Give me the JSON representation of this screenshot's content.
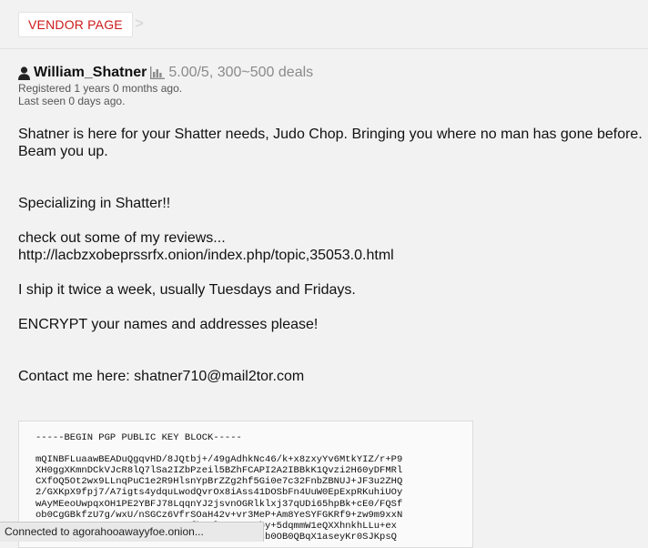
{
  "nav": {
    "vendor_page_label": "VENDOR PAGE",
    "separator": ">"
  },
  "vendor": {
    "name": "William_Shatner",
    "rating": "5.00/5, 300~500 deals",
    "registered": "Registered 1 years 0 months ago.",
    "last_seen": "Last seen 0 days ago."
  },
  "description": {
    "line1": "Shatner is here for your Shatter needs, Judo Chop. Bringing you where no man has gone before.",
    "line2": "Beam you up.",
    "specializing": "Specializing in Shatter!!",
    "reviews_intro": "check out some of my reviews...",
    "reviews_link": "http://lacbzxobeprssrfx.onion/index.php/topic,35053.0.html",
    "shipping": "I ship it twice a week, usually Tuesdays and Fridays.",
    "encrypt": "ENCRYPT your names and addresses please!",
    "contact": "Contact me here: shatner710@mail2tor.com"
  },
  "pgp": {
    "header": "-----BEGIN PGP PUBLIC KEY BLOCK-----",
    "lines": [
      "mQINBFLuaawBEADuQgqvHD/8JQtbj+/49gAdhkNc46/k+x8zxyYv6MtkYIZ/r+P9",
      "XH0ggXKmnDCkVJcR8lQ7lSa2IZbPzeil5BZhFCAPI2A2IBBkK1Qvzi2H60yDFMRl",
      "CXfOQ5Ot2wx9LLnqPuC1e2R9HlsnYpBrZZg2hf5Gi0e7c32FnbZBNUJ+JF3u2ZHQ",
      "2/GXKpX9fpj7/A7igts4ydquLwodQvrOx8iAss41DOSbFn4UuW0EpExpRKuhiUOy",
      "wAyMEeoUwpqxOH1PE2YBFJ78LqqnYJ2jsvnOGRlklxj37qUDi65hpBk+cE0/FQSf",
      "ob0CgGBkfzU7g/wxU/nSGCz6VfrSOaH42v+vr3MeP+Am8YeSYFGKRf9+zw9m9xxN",
      "w4tCHBRYvuQ1sOEDmaPnoFw6xFqfkgPlUYZzZymby+5dqmmW1eQXXhnkhLLu+ex",
      "kPaDN8bRwYkVLkmQTqqRxb9pLjWJyzGm2fk7Mwusb0OB0QBqX1aseyKr0SJKpsQ"
    ]
  },
  "statusbar": {
    "text": "Connected to agorahooawayyfoe.onion..."
  },
  "colors": {
    "accent": "#cc1a1a",
    "background": "#f2f2f2",
    "muted": "#8a8a8a"
  },
  "icons": {
    "user": "user-icon",
    "rating": "bar-chart-icon"
  }
}
